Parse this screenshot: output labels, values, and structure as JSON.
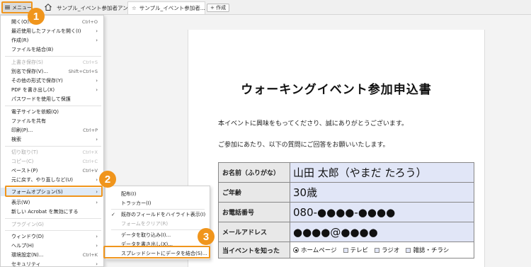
{
  "tabbar": {
    "menu_label": "メニュー",
    "tab1_label": "サンプル_イベント参加者アンケー...",
    "tab2_label": "サンプル_イベント参加者...",
    "tab2_close": "×",
    "new_label": "+ 作成"
  },
  "menu": {
    "items": [
      {
        "label": "開く(O)...",
        "shortcut": "Ctrl+O"
      },
      {
        "label": "最近使用したファイルを開く(I)",
        "arrow": "›"
      },
      {
        "label": "作成(R)",
        "arrow": "›"
      },
      {
        "label": "ファイルを結合(B)"
      },
      {
        "label": "上書き保存(S)",
        "shortcut": "Ctrl+S"
      },
      {
        "label": "別名で保存(V)...",
        "shortcut": "Shift+Ctrl+S"
      },
      {
        "label": "その他の形式で保存(Y)",
        "arrow": "›"
      },
      {
        "label": "PDF を書き出し(X)",
        "arrow": "›"
      },
      {
        "label": "パスワードを使用して保護"
      },
      {
        "label": "電子サインを依頼(Q)"
      },
      {
        "label": "ファイルを共有"
      },
      {
        "label": "印刷(P)...",
        "shortcut": "Ctrl+P"
      },
      {
        "label": "検索",
        "arrow": "›"
      },
      {
        "label": "切り取り(T)",
        "shortcut": "Ctrl+X"
      },
      {
        "label": "コピー(C)",
        "shortcut": "Ctrl+C"
      },
      {
        "label": "ペースト(P)",
        "shortcut": "Ctrl+V"
      },
      {
        "label": "元に戻す、やり直しなど(U)",
        "arrow": "›"
      },
      {
        "label": "フォームオプション(S)",
        "arrow": "›"
      },
      {
        "label": "表示(W)",
        "arrow": "›"
      },
      {
        "label": "新しい Acrobat を無効にする"
      },
      {
        "label": "プラグイン(G)"
      },
      {
        "label": "ウィンドウ(D)",
        "arrow": "›"
      },
      {
        "label": "ヘルプ(H)",
        "arrow": "›"
      },
      {
        "label": "環境設定(N)...",
        "shortcut": "Ctrl+K"
      },
      {
        "label": "セキュリティ",
        "arrow": "›"
      }
    ]
  },
  "submenu": {
    "items": [
      {
        "label": "配布(I)"
      },
      {
        "label": "トラッカー(I)"
      },
      {
        "label": "既存のフィールドをハイライト表示(I)",
        "check": "✓"
      },
      {
        "label": "フォームをクリア(R)"
      },
      {
        "label": "データを取り込み(I)..."
      },
      {
        "label": "データを書き出し(X)..."
      },
      {
        "label": "スプレッドシートにデータを結合(S)..."
      }
    ]
  },
  "document": {
    "title": "ウォーキングイベント参加申込書",
    "line1": "本イベントに興味をもってくださり、誠にありがとうございます。",
    "line2": "ご参加にあたり、以下の質問にご回答をお願いいたします。",
    "rows": [
      {
        "label": "お名前（ふりがな）",
        "value": "山田 太郎（やまだ たろう）"
      },
      {
        "label": "ご年齢",
        "value": "30歳"
      },
      {
        "label": "お電話番号",
        "value": "080-●●●●-●●●●"
      },
      {
        "label": "メールアドレス",
        "value": "●●●●@●●●●"
      },
      {
        "label": "当イベントを知った"
      }
    ],
    "options": [
      "ホームページ",
      "テレビ",
      "ラジオ",
      "雑誌・チラシ"
    ]
  },
  "badges": [
    "1",
    "2",
    "3"
  ],
  "colors": {
    "accent": "#f0951c",
    "field_bg": "#e1e6f7"
  }
}
